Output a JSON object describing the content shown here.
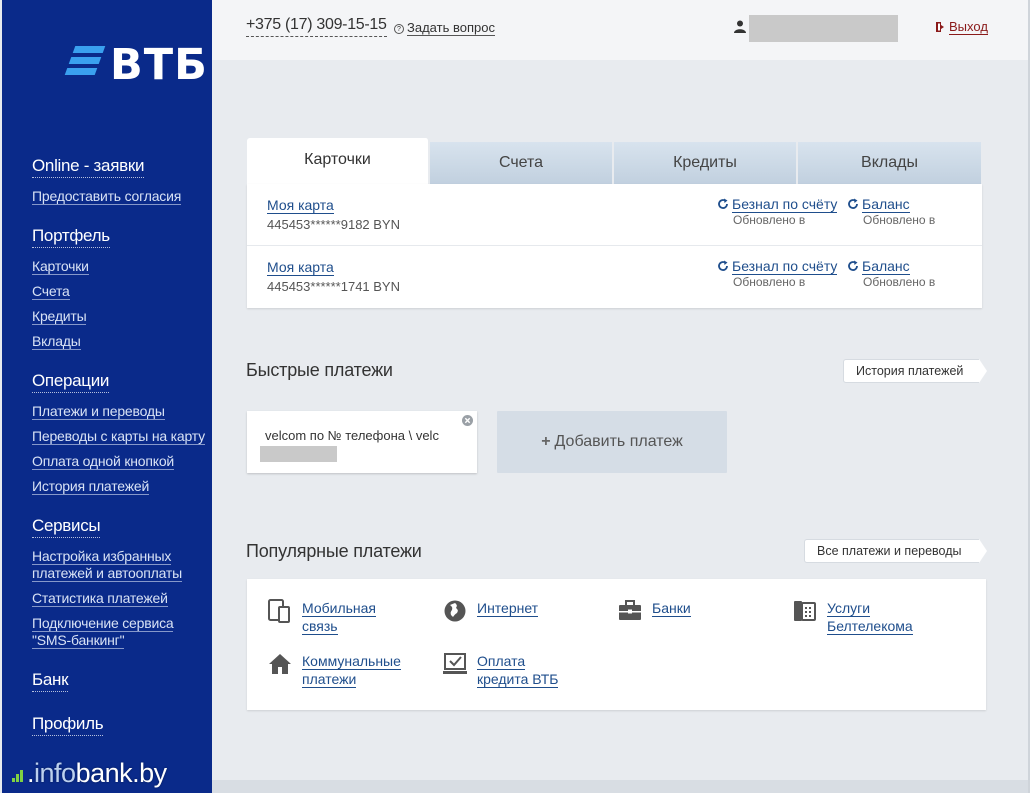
{
  "brand": {
    "name": "ВТБ"
  },
  "sidebar": {
    "groups": [
      {
        "title": "Online - заявки",
        "items": [
          "Предоставить согласия"
        ]
      },
      {
        "title": "Портфель",
        "items": [
          "Карточки",
          "Счета",
          "Кредиты",
          "Вклады"
        ]
      },
      {
        "title": "Операции",
        "items": [
          "Платежи и переводы",
          "Переводы с карты на карту",
          "Оплата одной кнопкой",
          "История платежей"
        ]
      },
      {
        "title": "Сервисы",
        "items": [
          "Настройка избранных платежей и автооплаты",
          "Статистика платежей",
          "Подключение сервиса \"SMS-банкинг\""
        ]
      },
      {
        "title": "Банк",
        "items": []
      },
      {
        "title": "Профиль",
        "items": []
      }
    ]
  },
  "watermark": {
    "prefix": ".",
    "dim": "info",
    "bright": "bank.by"
  },
  "header": {
    "phone": "+375 (17) 309-15-15",
    "ask_label": "Задать вопрос",
    "logout_label": "Выход"
  },
  "tabs": [
    "Карточки",
    "Счета",
    "Кредиты",
    "Вклады"
  ],
  "cards": [
    {
      "name": "Моя карта",
      "number": "445453******9182 BYN",
      "action1": "Безнал по счёту",
      "action2": "Баланс",
      "updated": "Обновлено в"
    },
    {
      "name": "Моя карта",
      "number": "445453******1741 BYN",
      "action1": "Безнал по счёту",
      "action2": "Баланс",
      "updated": "Обновлено в"
    }
  ],
  "quick_payments": {
    "title": "Быстрые платежи",
    "history_button": "История платежей",
    "card_text": "velcom по № телефона \\ velc",
    "add_label": "Добавить платеж"
  },
  "popular": {
    "title": "Популярные платежи",
    "all_button": "Все платежи и переводы",
    "items": [
      {
        "line1": "Мобильная",
        "line2": "связь",
        "icon": "mobile-icon"
      },
      {
        "line1": "Интернет",
        "line2": "",
        "icon": "globe-icon"
      },
      {
        "line1": "Банки",
        "line2": "",
        "icon": "briefcase-icon"
      },
      {
        "line1": "Услуги",
        "line2": "Белтелекома",
        "icon": "phone-icon"
      },
      {
        "line1": "Коммунальные",
        "line2": "платежи",
        "icon": "house-icon"
      },
      {
        "line1": "Оплата",
        "line2": "кредита ВТБ",
        "icon": "monitor-check-icon"
      }
    ]
  }
}
